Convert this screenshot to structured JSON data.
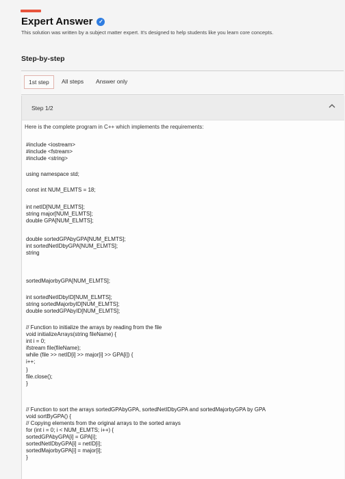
{
  "header": {
    "title": "Expert Answer",
    "subtitle": "This solution was written by a subject matter expert. It's designed to help students like you learn core concepts."
  },
  "step_heading": "Step-by-step",
  "tabs": [
    {
      "label": "1st step"
    },
    {
      "label": "All steps"
    },
    {
      "label": "Answer only"
    }
  ],
  "step": {
    "label": "Step 1/2",
    "intro": "Here is the complete program in C++ which implements the requirements:"
  },
  "code": [
    "#include <iostream>",
    "#include <fstream>",
    "#include <string>",
    "using namespace std;",
    "const int NUM_ELMTS = 18;",
    "int netID[NUM_ELMTS];",
    "string major[NUM_ELMTS];",
    "double GPA[NUM_ELMTS];",
    "double sortedGPAbyGPA[NUM_ELMTS];",
    "int sortedNetIDbyGPA[NUM_ELMTS];",
    "string",
    "sortedMajorbyGPA[NUM_ELMTS];",
    "int sortedNetIDbyID[NUM_ELMTS];",
    "string sortedMajorbyID[NUM_ELMTS];",
    "double sortedGPAbyID[NUM_ELMTS];",
    "// Function to initialize the arrays by reading from the file",
    "void initializeArrays(string fileName) {",
    "int i = 0;",
    "ifstream file(fileName);",
    "while (file >> netID[i] >> major[i] >> GPA[i]) {",
    "i++;",
    "}",
    "file.close();",
    "}",
    "// Function to sort the arrays sortedGPAbyGPA, sortedNetIDbyGPA and sortedMajorbyGPA by GPA",
    "void sortByGPA() {",
    "// Copying elements from the original arrays to the sorted arrays",
    "for (int i = 0; i < NUM_ELMTS; i++) {",
    "sortedGPAbyGPA[i] = GPA[i];",
    "sortedNetIDbyGPA[i] = netID[i];",
    "sortedMajorbyGPA[i] = major[i];",
    "}"
  ],
  "colors": {
    "accent": "#e8543c",
    "verified": "#2f7de1"
  }
}
